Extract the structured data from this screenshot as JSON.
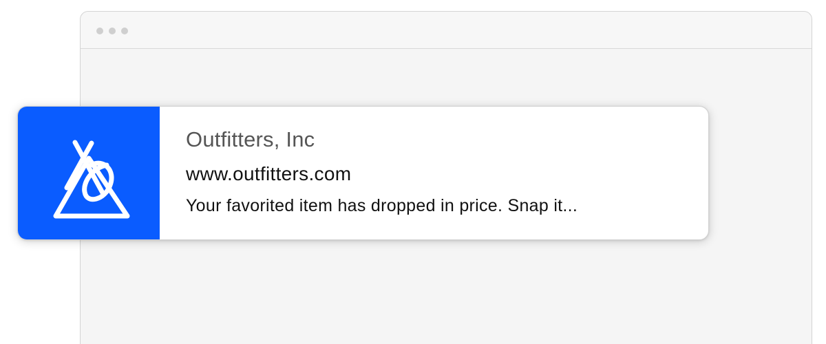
{
  "window": {
    "traffic_lights": [
      "close",
      "minimize",
      "zoom"
    ],
    "background_color": "#f5f5f5"
  },
  "notification": {
    "title": "Outfitters, Inc",
    "subtitle": "www.outfitters.com",
    "message": "Your favorited item has dropped in price. Snap it...",
    "icon": "outfitters-logo-icon",
    "accent_color": "#0a5cff"
  }
}
